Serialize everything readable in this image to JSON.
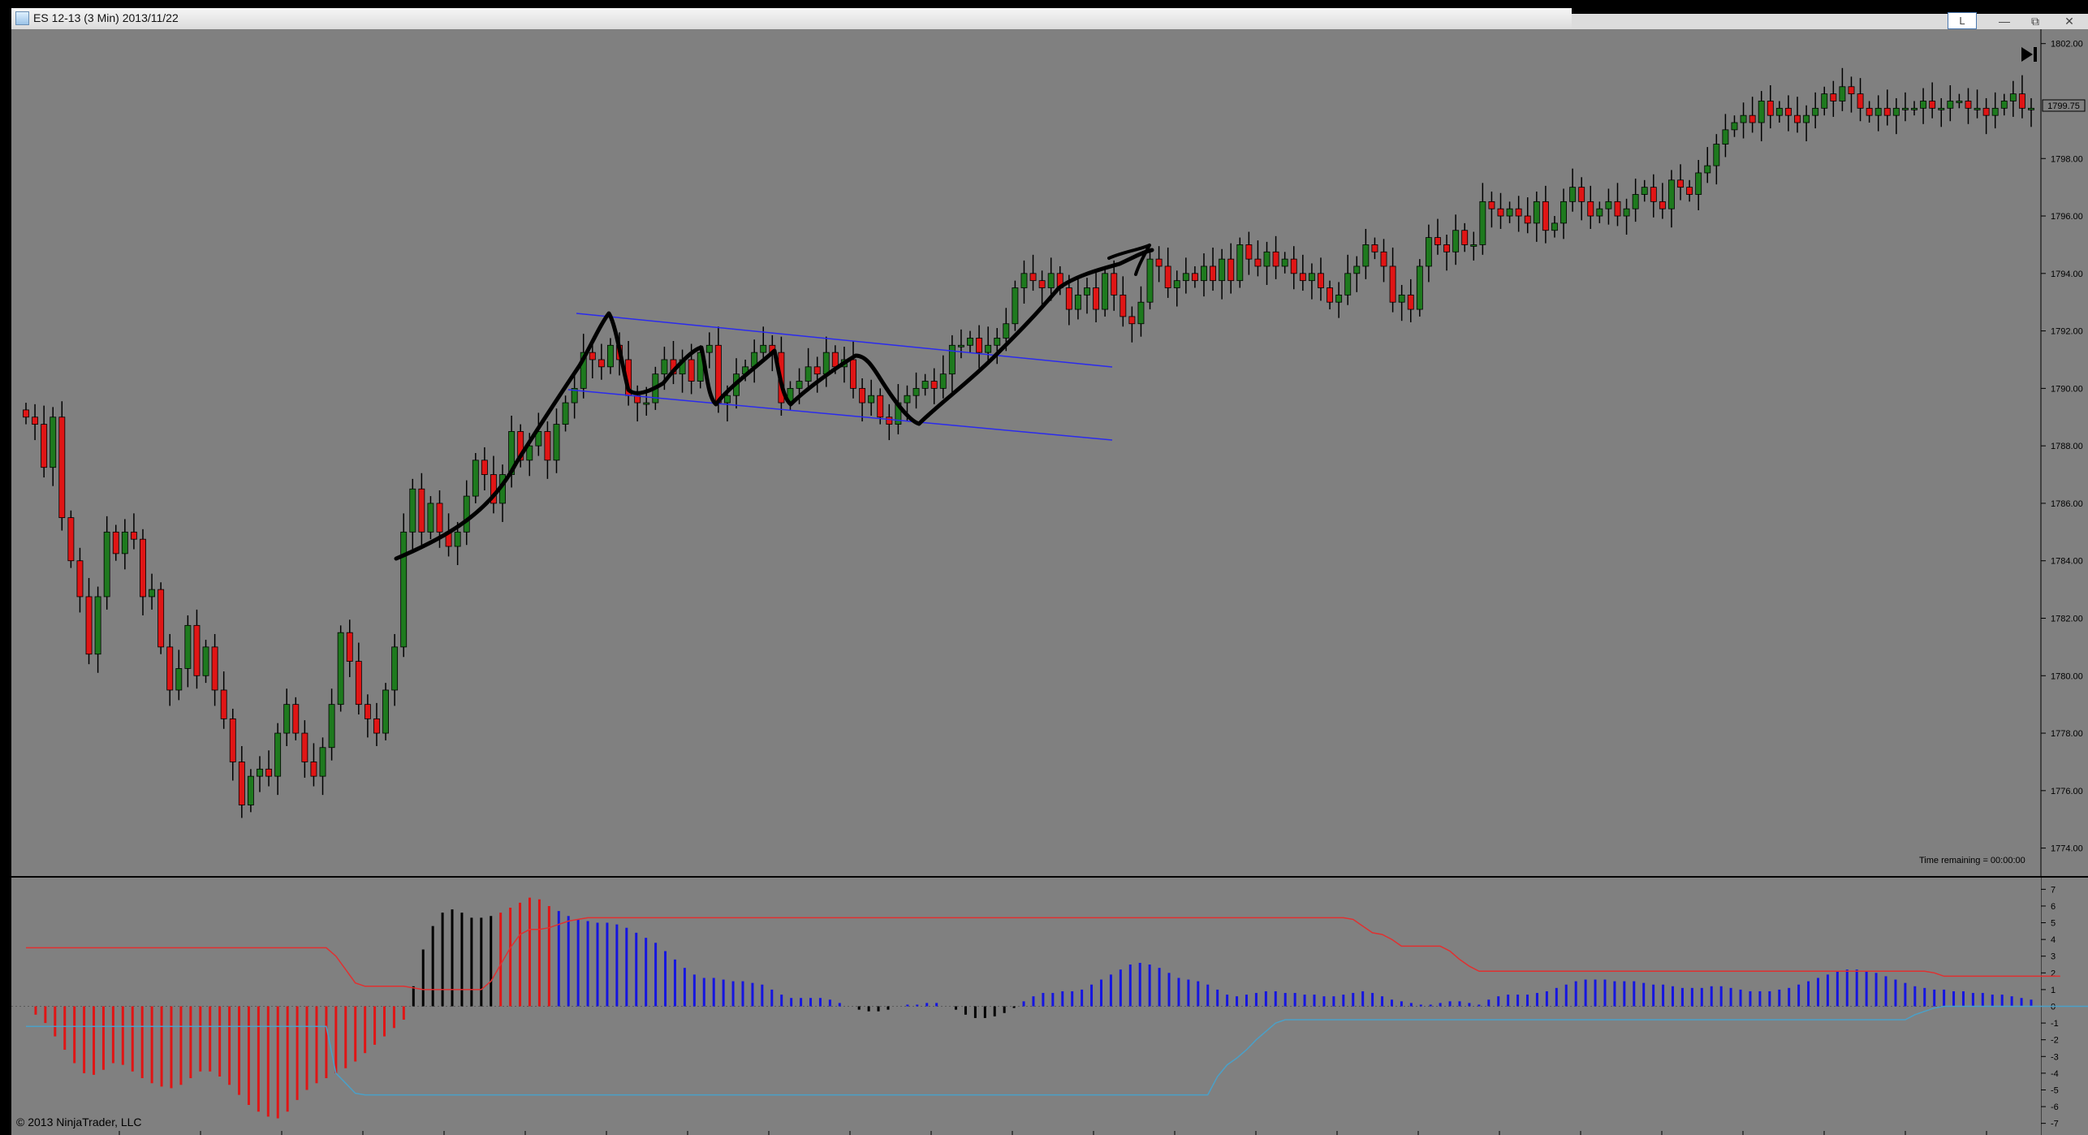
{
  "window": {
    "title": "ES 12-13 (3 Min)  2013/11/22",
    "link_button": "L",
    "minimize_glyph": "—",
    "maximize_glyph": "⧉",
    "close_glyph": "✕"
  },
  "chart_data": {
    "type": "candlestick",
    "instrument": "ES 12-13",
    "interval": "3 Min",
    "date": "2013/11/22",
    "price_axis": {
      "min": 1773.0,
      "max": 1802.5,
      "ticks": [
        "1774.00",
        "1776.00",
        "1778.00",
        "1780.00",
        "1782.00",
        "1784.00",
        "1786.00",
        "1788.00",
        "1790.00",
        "1792.00",
        "1794.00",
        "1796.00",
        "1798.00",
        "1802.00"
      ],
      "last_price_label": "1799.75",
      "last_price": 1799.75
    },
    "indicator_axis": {
      "min": -7.6,
      "max": 7.6,
      "ticks": [
        "7",
        "6",
        "5",
        "4",
        "3",
        "2",
        "1",
        "0",
        "-1",
        "-2",
        "-3",
        "-4",
        "-5",
        "-6",
        "-7"
      ]
    },
    "colors": {
      "up_candle": "#1e7a1e",
      "down_candle": "#e01515",
      "wick": "#000000",
      "channel_line": "#2a2aee",
      "pos_bar": "#1515e0",
      "neg_bar": "#e01515",
      "neutral_bar": "#000000",
      "upper_band": "#e03030",
      "lower_band": "#4aa0c8",
      "background": "#808080"
    },
    "closes": [
      1789.0,
      1788.75,
      1787.25,
      1789.0,
      1785.5,
      1784.0,
      1782.75,
      1780.75,
      1782.75,
      1785.0,
      1784.25,
      1785.0,
      1784.75,
      1782.75,
      1783.0,
      1781.0,
      1779.5,
      1780.25,
      1781.75,
      1780.0,
      1781.0,
      1779.5,
      1778.5,
      1777.0,
      1775.5,
      1776.5,
      1776.75,
      1776.5,
      1778.0,
      1779.0,
      1778.0,
      1777.0,
      1776.5,
      1777.5,
      1779.0,
      1781.5,
      1780.5,
      1779.0,
      1778.5,
      1778.0,
      1779.5,
      1781.0,
      1785.0,
      1786.5,
      1785.0,
      1786.0,
      1785.0,
      1784.5,
      1785.0,
      1786.25,
      1787.5,
      1787.0,
      1786.0,
      1787.0,
      1788.5,
      1787.5,
      1788.0,
      1788.5,
      1787.5,
      1788.75,
      1789.5,
      1790.0,
      1791.25,
      1791.0,
      1790.75,
      1791.5,
      1791.0,
      1789.75,
      1789.5,
      1789.5,
      1790.5,
      1791.0,
      1790.5,
      1791.0,
      1790.25,
      1791.25,
      1791.5,
      1789.5,
      1789.75,
      1790.5,
      1790.75,
      1791.25,
      1791.5,
      1791.25,
      1789.5,
      1790.0,
      1790.25,
      1790.75,
      1790.5,
      1791.25,
      1790.75,
      1791.0,
      1790.0,
      1789.5,
      1789.75,
      1789.0,
      1788.75,
      1789.5,
      1789.75,
      1790.0,
      1790.25,
      1790.0,
      1790.5,
      1791.5,
      1791.5,
      1791.75,
      1791.25,
      1791.5,
      1791.75,
      1792.25,
      1793.5,
      1794.0,
      1793.75,
      1793.5,
      1794.0,
      1793.5,
      1792.75,
      1793.25,
      1793.5,
      1792.75,
      1794.0,
      1793.25,
      1792.5,
      1792.25,
      1793.0,
      1794.5,
      1794.25,
      1793.5,
      1793.75,
      1794.0,
      1793.75,
      1794.25,
      1793.75,
      1794.5,
      1793.75,
      1795.0,
      1794.5,
      1794.25,
      1794.75,
      1794.25,
      1794.5,
      1794.0,
      1793.75,
      1794.0,
      1793.5,
      1793.0,
      1793.25,
      1794.0,
      1794.25,
      1795.0,
      1794.75,
      1794.25,
      1793.0,
      1793.25,
      1792.75,
      1794.25,
      1795.25,
      1795.0,
      1794.75,
      1795.5,
      1795.0,
      1795.0,
      1796.5,
      1796.25,
      1796.0,
      1796.25,
      1796.0,
      1795.75,
      1796.5,
      1795.5,
      1795.75,
      1796.5,
      1797.0,
      1796.5,
      1796.0,
      1796.25,
      1796.5,
      1796.0,
      1796.25,
      1796.75,
      1797.0,
      1796.5,
      1796.25,
      1797.25,
      1797.0,
      1796.75,
      1797.5,
      1797.75,
      1798.5,
      1799.0,
      1799.25,
      1799.5,
      1799.25,
      1800.0,
      1799.5,
      1799.75,
      1799.5,
      1799.25,
      1799.5,
      1799.75,
      1800.25,
      1800.0,
      1800.5,
      1800.25,
      1799.75,
      1799.5,
      1799.75,
      1799.5,
      1799.75,
      1799.75,
      1799.75,
      1800.0,
      1799.75,
      1799.75,
      1800.0,
      1800.0,
      1799.75,
      1799.75,
      1799.5,
      1799.75,
      1800.0,
      1800.25,
      1799.75,
      1799.75
    ],
    "oscillator": [
      0.0,
      -0.5,
      -1.0,
      -1.8,
      -2.6,
      -3.4,
      -4.0,
      -4.1,
      -3.8,
      -3.4,
      -3.5,
      -3.9,
      -4.3,
      -4.6,
      -4.8,
      -4.9,
      -4.7,
      -4.3,
      -3.9,
      -3.9,
      -4.2,
      -4.7,
      -5.3,
      -5.9,
      -6.3,
      -6.6,
      -6.7,
      -6.3,
      -5.6,
      -5.0,
      -4.6,
      -4.3,
      -4.0,
      -3.7,
      -3.3,
      -2.8,
      -2.3,
      -1.8,
      -1.3,
      -0.8,
      1.2,
      3.4,
      4.8,
      5.6,
      5.8,
      5.6,
      5.3,
      5.3,
      5.4,
      5.6,
      5.9,
      6.2,
      6.5,
      6.4,
      6.0,
      5.7,
      5.4,
      5.2,
      5.1,
      5.0,
      5.0,
      4.9,
      4.7,
      4.4,
      4.1,
      3.8,
      3.3,
      2.8,
      2.3,
      1.9,
      1.7,
      1.7,
      1.6,
      1.5,
      1.5,
      1.4,
      1.3,
      1.0,
      0.7,
      0.5,
      0.5,
      0.5,
      0.5,
      0.4,
      0.2,
      0.0,
      -0.2,
      -0.3,
      -0.3,
      -0.2,
      0.0,
      0.1,
      0.1,
      0.2,
      0.2,
      0.0,
      -0.2,
      -0.5,
      -0.7,
      -0.7,
      -0.6,
      -0.4,
      -0.1,
      0.3,
      0.6,
      0.8,
      0.8,
      0.9,
      0.9,
      1.0,
      1.3,
      1.6,
      1.9,
      2.2,
      2.5,
      2.6,
      2.5,
      2.3,
      2.0,
      1.7,
      1.6,
      1.5,
      1.3,
      1.0,
      0.7,
      0.6,
      0.7,
      0.8,
      0.9,
      0.9,
      0.8,
      0.8,
      0.7,
      0.7,
      0.6,
      0.6,
      0.7,
      0.8,
      0.9,
      0.8,
      0.6,
      0.4,
      0.3,
      0.2,
      0.1,
      0.1,
      0.2,
      0.3,
      0.3,
      0.2,
      0.1,
      0.4,
      0.6,
      0.7,
      0.7,
      0.7,
      0.8,
      0.9,
      1.1,
      1.3,
      1.5,
      1.6,
      1.6,
      1.6,
      1.5,
      1.5,
      1.5,
      1.4,
      1.3,
      1.3,
      1.2,
      1.1,
      1.1,
      1.1,
      1.2,
      1.2,
      1.1,
      1.0,
      0.9,
      0.9,
      0.9,
      1.0,
      1.1,
      1.3,
      1.5,
      1.7,
      1.9,
      2.1,
      2.2,
      2.2,
      2.1,
      2.0,
      1.8,
      1.6,
      1.4,
      1.2,
      1.1,
      1.0,
      1.0,
      0.9,
      0.9,
      0.8,
      0.8,
      0.7,
      0.7,
      0.6,
      0.5,
      0.4
    ],
    "upper_band": [
      3.5,
      3.5,
      3.5,
      3.5,
      3.5,
      3.5,
      3.5,
      3.5,
      3.5,
      3.5,
      3.5,
      3.5,
      3.5,
      3.5,
      3.5,
      3.5,
      3.5,
      3.5,
      3.5,
      3.5,
      3.5,
      3.5,
      3.5,
      3.5,
      3.5,
      3.5,
      3.5,
      3.5,
      3.5,
      3.5,
      3.5,
      3.5,
      3.0,
      2.2,
      1.4,
      1.2,
      1.2,
      1.2,
      1.2,
      1.2,
      1.1,
      1.0,
      1.0,
      1.0,
      1.0,
      1.0,
      1.0,
      1.0,
      1.5,
      2.5,
      3.5,
      4.3,
      4.6,
      4.6,
      4.7,
      4.9,
      5.1,
      5.2,
      5.3,
      5.3,
      5.3,
      5.3,
      5.3,
      5.3,
      5.3,
      5.3,
      5.3,
      5.3,
      5.3,
      5.3,
      5.3,
      5.3,
      5.3,
      5.3,
      5.3,
      5.3,
      5.3,
      5.3,
      5.3,
      5.3,
      5.3,
      5.3,
      5.3,
      5.3,
      5.3,
      5.3,
      5.3,
      5.3,
      5.3,
      5.3,
      5.3,
      5.3,
      5.3,
      5.3,
      5.3,
      5.3,
      5.3,
      5.3,
      5.3,
      5.3,
      5.3,
      5.3,
      5.3,
      5.3,
      5.3,
      5.3,
      5.3,
      5.3,
      5.3,
      5.3,
      5.3,
      5.3,
      5.3,
      5.3,
      5.3,
      5.3,
      5.3,
      5.3,
      5.3,
      5.3,
      5.3,
      5.3,
      5.3,
      5.3,
      5.3,
      5.3,
      5.3,
      5.3,
      5.3,
      5.3,
      5.3,
      5.3,
      5.3,
      5.3,
      5.3,
      5.3,
      5.3,
      5.2,
      4.8,
      4.4,
      4.3,
      4.0,
      3.6,
      3.6,
      3.6,
      3.6,
      3.6,
      3.3,
      2.8,
      2.4,
      2.1,
      2.1,
      2.1,
      2.1,
      2.1,
      2.1,
      2.1,
      2.1,
      2.1,
      2.1,
      2.1,
      2.1,
      2.1,
      2.1,
      2.1,
      2.1,
      2.1,
      2.1,
      2.1,
      2.1,
      2.1,
      2.1,
      2.1,
      2.1,
      2.1,
      2.1,
      2.1,
      2.1,
      2.1,
      2.1,
      2.1,
      2.1,
      2.1,
      2.1,
      2.1,
      2.1,
      2.1,
      2.1,
      2.1,
      2.1,
      2.1,
      2.1,
      2.1,
      2.1,
      2.1,
      2.1,
      2.1,
      2.0,
      1.8,
      1.8,
      1.8,
      1.8,
      1.8,
      1.8,
      1.8,
      1.8,
      1.8,
      1.8,
      1.8,
      1.8,
      1.8
    ],
    "lower_band": [
      -1.2,
      -1.2,
      -1.2,
      -1.2,
      -1.2,
      -1.2,
      -1.2,
      -1.2,
      -1.2,
      -1.2,
      -1.2,
      -1.2,
      -1.2,
      -1.2,
      -1.2,
      -1.2,
      -1.2,
      -1.2,
      -1.2,
      -1.2,
      -1.2,
      -1.2,
      -1.2,
      -1.2,
      -1.2,
      -1.2,
      -1.2,
      -1.2,
      -1.2,
      -1.2,
      -1.2,
      -1.2,
      -4.0,
      -4.6,
      -5.2,
      -5.3,
      -5.3,
      -5.3,
      -5.3,
      -5.3,
      -5.3,
      -5.3,
      -5.3,
      -5.3,
      -5.3,
      -5.3,
      -5.3,
      -5.3,
      -5.3,
      -5.3,
      -5.3,
      -5.3,
      -5.3,
      -5.3,
      -5.3,
      -5.3,
      -5.3,
      -5.3,
      -5.3,
      -5.3,
      -5.3,
      -5.3,
      -5.3,
      -5.3,
      -5.3,
      -5.3,
      -5.3,
      -5.3,
      -5.3,
      -5.3,
      -5.3,
      -5.3,
      -5.3,
      -5.3,
      -5.3,
      -5.3,
      -5.3,
      -5.3,
      -5.3,
      -5.3,
      -5.3,
      -5.3,
      -5.3,
      -5.3,
      -5.3,
      -5.3,
      -5.3,
      -5.3,
      -5.3,
      -5.3,
      -5.3,
      -5.3,
      -5.3,
      -5.3,
      -5.3,
      -5.3,
      -5.3,
      -5.3,
      -5.3,
      -5.3,
      -5.3,
      -5.3,
      -5.3,
      -5.3,
      -5.3,
      -5.3,
      -5.3,
      -5.3,
      -5.3,
      -5.3,
      -5.3,
      -5.3,
      -5.3,
      -5.3,
      -5.3,
      -5.3,
      -5.3,
      -5.3,
      -5.3,
      -5.3,
      -5.3,
      -5.3,
      -5.3,
      -4.2,
      -3.5,
      -3.1,
      -2.6,
      -2.0,
      -1.5,
      -1.0,
      -0.8,
      -0.8,
      -0.8,
      -0.8,
      -0.8,
      -0.8,
      -0.8,
      -0.8,
      -0.8,
      -0.8,
      -0.8,
      -0.8,
      -0.8,
      -0.8,
      -0.8,
      -0.8,
      -0.8,
      -0.8,
      -0.8,
      -0.8,
      -0.8,
      -0.8,
      -0.8,
      -0.8,
      -0.8,
      -0.8,
      -0.8,
      -0.8,
      -0.8,
      -0.8,
      -0.8,
      -0.8,
      -0.8,
      -0.8,
      -0.8,
      -0.8,
      -0.8,
      -0.8,
      -0.8,
      -0.8,
      -0.8,
      -0.8,
      -0.8,
      -0.8,
      -0.8,
      -0.8,
      -0.8,
      -0.8,
      -0.8,
      -0.8,
      -0.8,
      -0.8,
      -0.8,
      -0.8,
      -0.8,
      -0.8,
      -0.8,
      -0.8,
      -0.8,
      -0.8,
      -0.8,
      -0.8,
      -0.8,
      -0.8,
      -0.8,
      -0.5,
      -0.3,
      -0.1,
      0.0,
      0.0,
      0.0,
      0.0,
      0.0,
      0.0,
      0.0,
      0.0,
      0.0,
      0.0,
      0.0,
      0.0,
      0.0,
      0.0,
      0.0,
      0.0,
      0.0,
      0.0,
      0.0,
      0.0,
      0.0
    ]
  },
  "status": {
    "time_remaining": "Time remaining = 00:00:00",
    "copyright": "© 2013 NinjaTrader, LLC"
  },
  "icons": {
    "play_end": "play-to-end-icon",
    "app": "ninjatrader-app-icon"
  }
}
